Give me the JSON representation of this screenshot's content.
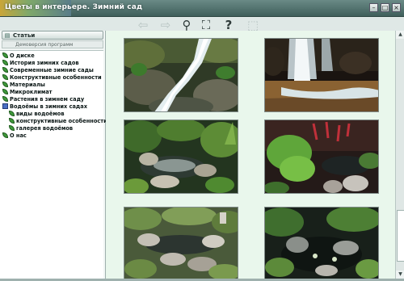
{
  "window": {
    "title": "Цветы в интерьере. Зимний сад",
    "buttons": [
      "–",
      "□",
      "×"
    ]
  },
  "toolbar": {
    "buttons": [
      {
        "icon": "arrow-left-icon",
        "glyph": "⇦",
        "enabled": false
      },
      {
        "icon": "arrow-right-icon",
        "glyph": "⇨",
        "enabled": false
      },
      {
        "icon": "magnifier-icon",
        "glyph": "⚲",
        "enabled": true
      },
      {
        "icon": "fullscreen-icon",
        "glyph": "⛶",
        "enabled": true
      },
      {
        "icon": "help-icon",
        "glyph": "?",
        "enabled": true
      },
      {
        "icon": "frame-icon",
        "glyph": "⬚",
        "enabled": false
      }
    ]
  },
  "sidebar": {
    "tab_label": "Статьи",
    "demo_label": "Демоверсия программ",
    "items": [
      {
        "label": "О диске",
        "icon": "leaf-icon",
        "level": 0
      },
      {
        "label": "История зимних садов",
        "icon": "leaf-icon",
        "level": 0
      },
      {
        "label": "Современные зимние сады",
        "icon": "leaf-icon",
        "level": 0
      },
      {
        "label": "Конструктивные особенности",
        "icon": "leaf-icon",
        "level": 0
      },
      {
        "label": "Материалы",
        "icon": "leaf-icon",
        "level": 0
      },
      {
        "label": "Микроклимат",
        "icon": "leaf-icon",
        "level": 0
      },
      {
        "label": "Растения в зимнем саду",
        "icon": "leaf-icon",
        "level": 0
      },
      {
        "label": "Водоёмы в зимних садах",
        "icon": "book-icon",
        "level": 0
      },
      {
        "label": "виды водоёмов",
        "icon": "leaf-icon",
        "level": 1
      },
      {
        "label": "конструктивные особенности",
        "icon": "leaf-icon",
        "level": 1
      },
      {
        "label": "галерея водоёмов",
        "icon": "leaf-icon",
        "level": 1
      },
      {
        "label": "О нас",
        "icon": "leaf-icon",
        "level": 0
      }
    ]
  },
  "gallery": {
    "photos": [
      {
        "name": "waterfall-rocks"
      },
      {
        "name": "waterfall-dark"
      },
      {
        "name": "garden-pond-stones"
      },
      {
        "name": "pond-red-plants"
      },
      {
        "name": "rock-garden-pond"
      },
      {
        "name": "dark-pond-rocks"
      }
    ]
  },
  "colors": {
    "title_bar": "#3f5f5b",
    "content_bg": "#e9f7ec",
    "tree_bg": "#ffffff",
    "leaf": "#3f9a3a"
  }
}
